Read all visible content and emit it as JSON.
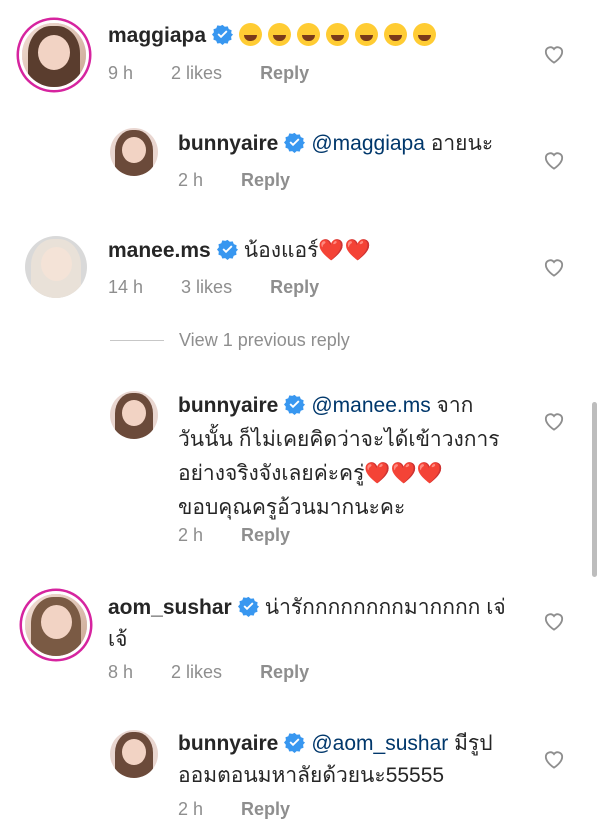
{
  "comments": [
    {
      "username": "maggiapa",
      "text": "😂😂😂😂😂😂😂",
      "time": "9 h",
      "likes": "2 likes",
      "reply_label": "Reply"
    },
    {
      "username": "bunnyaire",
      "mention": "@maggiapa",
      "text": " อายนะ",
      "time": "2 h",
      "reply_label": "Reply"
    },
    {
      "username": "manee.ms",
      "text": "น้องแอร์",
      "hearts": "❤️❤️",
      "time": "14 h",
      "likes": "3 likes",
      "reply_label": "Reply"
    },
    {
      "username": "bunnyaire",
      "mention": "@manee.ms",
      "text_line1": " จาก",
      "text_line2": "วันนั้น ก็ไม่เคยคิดว่าจะได้เข้าวงการ",
      "text_line3": "อย่างจริงจังเลยค่ะครู่",
      "hearts": "❤️❤️❤️",
      "text_line4": "ขอบคุณครูอ้วนมากนะคะ",
      "time": "2 h",
      "reply_label": "Reply"
    },
    {
      "username": "aom_sushar",
      "text_line1": "น่ารักกกกกกกกมากกกก เจ่",
      "text_line2": "เจ้",
      "time": "8 h",
      "likes": "2 likes",
      "reply_label": "Reply"
    },
    {
      "username": "bunnyaire",
      "mention": "@aom_sushar",
      "text_line1": " มีรูป",
      "text_line2": "ออมตอนมหาลัยด้วยนะ55555",
      "time": "2 h",
      "reply_label": "Reply"
    }
  ],
  "view_previous": "View 1 previous reply",
  "colors": {
    "verified": "#3897f0",
    "mention": "#00376b",
    "meta": "#8e8e8e",
    "heart": "#e0245e"
  }
}
